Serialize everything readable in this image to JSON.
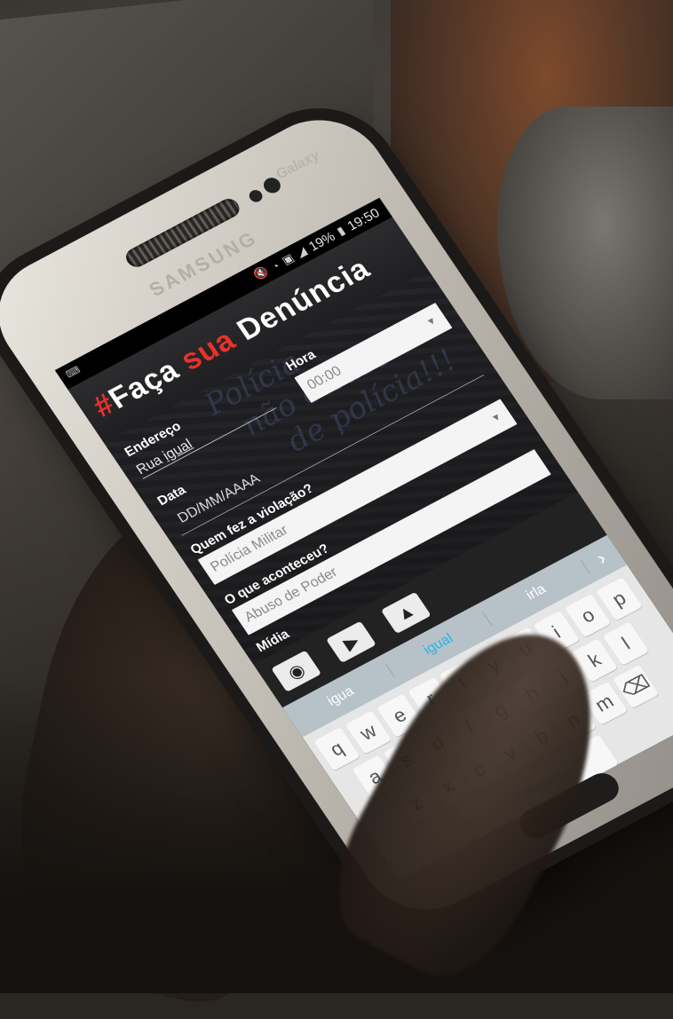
{
  "device": {
    "brand": "SAMSUNG",
    "brand_top": "Galaxy"
  },
  "status_bar": {
    "battery": "19%",
    "time": "19:50"
  },
  "app": {
    "title_hash": "#",
    "title_faca": "Faça",
    "title_sua": "sua",
    "title_denuncia": "Denúncia",
    "colors": {
      "accent": "#e8322b",
      "text": "#ffffff"
    }
  },
  "form": {
    "endereco_label": "Endereço",
    "endereco_prefix": "Rua ",
    "endereco_value": "igual",
    "hora_label": "Hora",
    "hora_value": "00:00",
    "data_label": "Data",
    "data_placeholder": "DD/MM/AAAA",
    "quem_label": "Quem fez a violação?",
    "quem_value": "Polícia Militar",
    "oque_label": "O que aconteceu?",
    "oque_value": "Abuso de Poder",
    "midia_label": "Mídia"
  },
  "media": {
    "icons": [
      "camera-icon",
      "video-icon",
      "image-icon"
    ]
  },
  "keyboard": {
    "suggestions": [
      "igua",
      "igual",
      "irla"
    ],
    "row1": [
      "q",
      "w",
      "e",
      "r",
      "t",
      "y",
      "u",
      "i",
      "o",
      "p"
    ],
    "row2": [
      "a",
      "s",
      "d",
      "f",
      "g",
      "h",
      "j",
      "k",
      "l"
    ],
    "row3": [
      "z",
      "x",
      "c",
      "v",
      "b",
      "n",
      "m"
    ],
    "space_label": "Português",
    "highlight_color": "#22a9dd"
  }
}
